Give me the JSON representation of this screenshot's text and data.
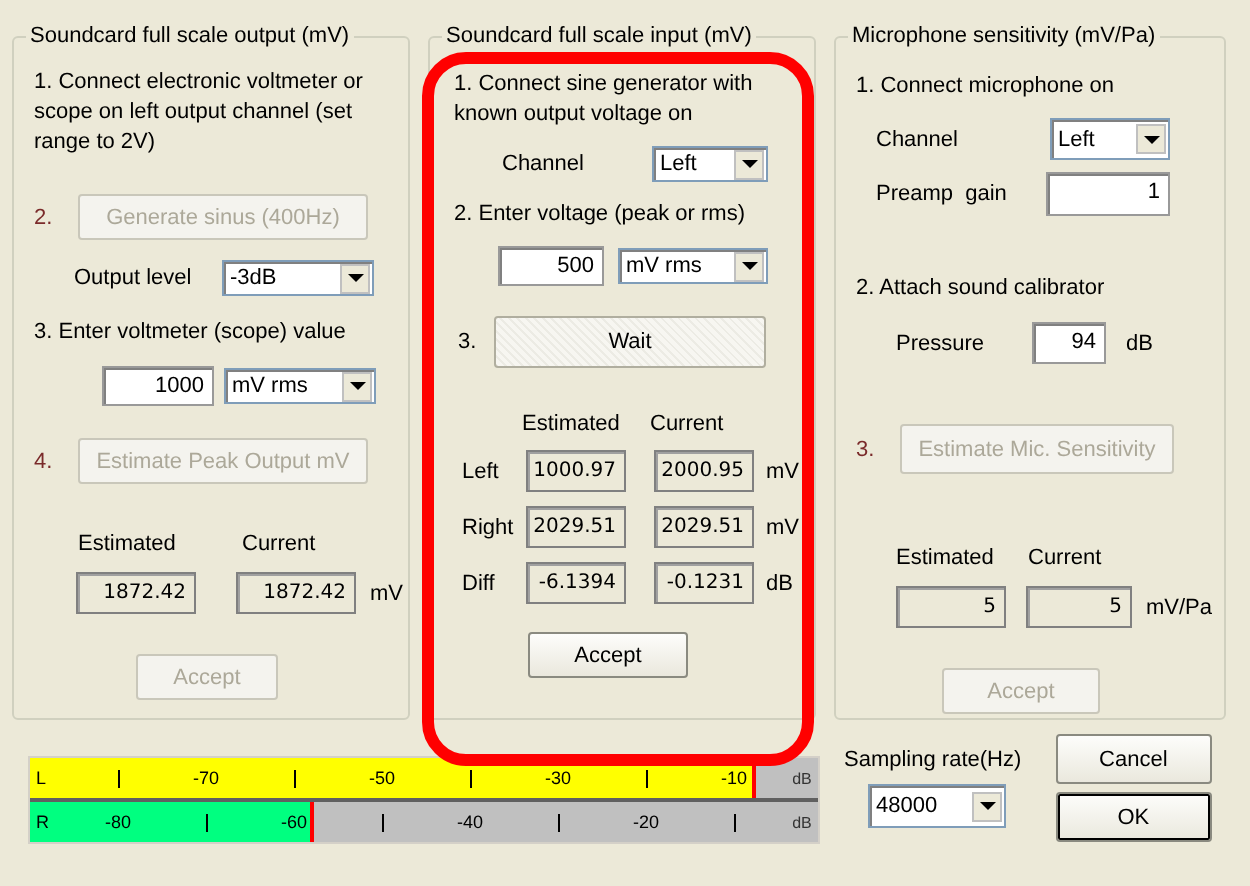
{
  "output_panel": {
    "title": "Soundcard full scale output (mV)",
    "step1": "1. Connect electronic voltmeter or scope on left output channel (set range  to 2V)",
    "step2_number": "2.",
    "generate_button": {
      "label": "Generate sinus (400Hz)",
      "disabled": true
    },
    "output_level": {
      "label": "Output level",
      "value": "-3dB"
    },
    "step3": "3. Enter voltmeter (scope) value",
    "voltage": {
      "value": "1000",
      "unit": "mV rms"
    },
    "step4_number": "4.",
    "estimate_button": {
      "label": "Estimate Peak Output mV",
      "disabled": true
    },
    "estimated_header": "Estimated",
    "current_header": "Current",
    "estimated": "1872.42",
    "current": "1872.42",
    "unit": "mV",
    "accept_button": {
      "label": "Accept",
      "disabled": true
    }
  },
  "input_panel": {
    "title": "Soundcard full scale  input (mV)",
    "step1": "1. Connect sine generator with known output voltage on",
    "channel": {
      "label": "Channel",
      "value": "Left"
    },
    "step2": "2. Enter voltage (peak or rms)",
    "voltage": {
      "value": "500",
      "unit": "mV rms"
    },
    "step3_number": "3.",
    "wait_button": {
      "label": "Wait",
      "busy": true
    },
    "estimated_header": "Estimated",
    "current_header": "Current",
    "rows": [
      {
        "label": "Left",
        "estimated": "1000.97",
        "current": "2000.95",
        "unit": "mV"
      },
      {
        "label": "Right",
        "estimated": "2029.51",
        "current": "2029.51",
        "unit": "mV"
      },
      {
        "label": "Diff",
        "estimated": "-6.1394",
        "current": "-0.1231",
        "unit": "dB"
      }
    ],
    "accept_button": {
      "label": "Accept",
      "disabled": false
    }
  },
  "mic_panel": {
    "title": "Microphone sensitivity (mV/Pa)",
    "step1": "1. Connect microphone on",
    "channel": {
      "label": "Channel",
      "value": "Left"
    },
    "preamp": {
      "label": "Preamp  gain",
      "value": "1"
    },
    "step2": "2. Attach sound calibrator",
    "pressure": {
      "label": "Pressure",
      "value": "94",
      "unit": "dB"
    },
    "step3_number": "3.",
    "estimate_button": {
      "label": "Estimate Mic. Sensitivity",
      "disabled": true
    },
    "estimated_header": "Estimated",
    "current_header": "Current",
    "estimated": "5",
    "current": "5",
    "unit": "mV/Pa",
    "accept_button": {
      "label": "Accept",
      "disabled": true
    }
  },
  "level_meter": {
    "channels": [
      {
        "name": "L",
        "level": 0.96,
        "color": "#ffff00",
        "unit": "dB",
        "marks": [
          {
            "kind": "tick"
          },
          {
            "kind": "label",
            "text": "-70"
          },
          {
            "kind": "tick"
          },
          {
            "kind": "label",
            "text": "-50"
          },
          {
            "kind": "tick"
          },
          {
            "kind": "label",
            "text": "-30"
          },
          {
            "kind": "tick"
          },
          {
            "kind": "label",
            "text": "-10"
          }
        ]
      },
      {
        "name": "R",
        "level": 0.375,
        "color": "#00ff80",
        "unit": "dB",
        "marks": [
          {
            "kind": "label",
            "text": "-80"
          },
          {
            "kind": "tick"
          },
          {
            "kind": "label",
            "text": "-60"
          },
          {
            "kind": "tick"
          },
          {
            "kind": "label",
            "text": "-40"
          },
          {
            "kind": "tick"
          },
          {
            "kind": "label",
            "text": "-20"
          },
          {
            "kind": "tick"
          }
        ]
      }
    ]
  },
  "sampling_rate": {
    "label": "Sampling rate(Hz)",
    "value": "48000"
  },
  "buttons": [
    {
      "label": "Cancel",
      "default": false
    },
    {
      "label": "OK",
      "default": true
    }
  ]
}
